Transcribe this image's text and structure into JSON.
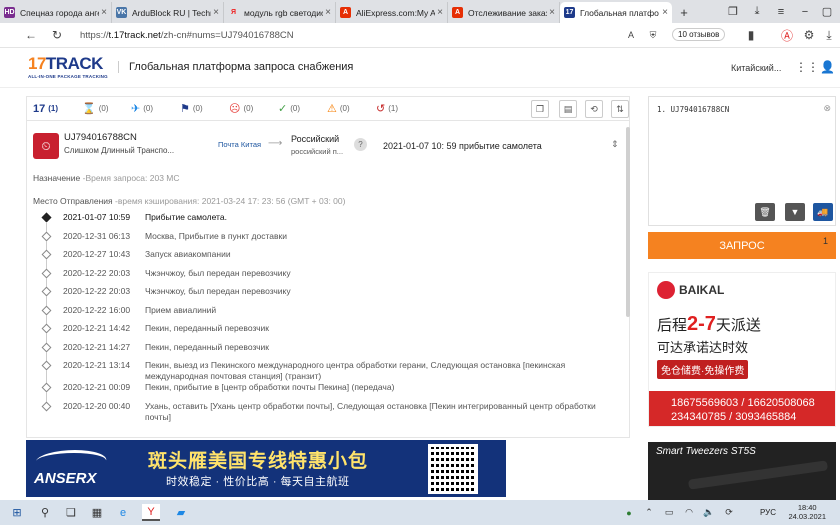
{
  "browser": {
    "tabs": [
      {
        "label": "Спецназ города анге",
        "favicon": "HD",
        "color": "#7a2d8f"
      },
      {
        "label": "ArduBlock RU | Techn",
        "favicon": "VK",
        "color": "#4a76a8"
      },
      {
        "label": "модуль rgb светодио",
        "favicon": "Я",
        "color": "#ffffff"
      },
      {
        "label": "AliExpress.com:My Al",
        "favicon": "A",
        "color": "#e62e04"
      },
      {
        "label": "Отслеживание заказ",
        "favicon": "A",
        "color": "#e62e04"
      },
      {
        "label": "Глобальная платфо",
        "favicon": "17",
        "color": "#1e3a8a",
        "active": true
      }
    ],
    "new_tab": "+",
    "url_prefix": "https://",
    "url_domain": "t.17track.net",
    "url_rest": "/zh-cn#nums=UJ794016788CN",
    "reviews_label": "10 отзывов"
  },
  "site": {
    "logo_main": "17TRACK",
    "logo_tagline": "ALL-IN-ONE PACKAGE TRACKING",
    "title": "Глобальная платформа запроса снабжения",
    "language": "Китайский..."
  },
  "filters": [
    {
      "icon": "17",
      "count": "(1)",
      "name": "all"
    },
    {
      "icon": "⌛",
      "count": "(0)",
      "name": "not-found"
    },
    {
      "icon": "✈",
      "count": "(0)",
      "name": "in-transit"
    },
    {
      "icon": "⚑",
      "count": "(0)",
      "name": "pick-up"
    },
    {
      "icon": "☹",
      "count": "(0)",
      "name": "undelivered"
    },
    {
      "icon": "✓",
      "count": "(0)",
      "name": "delivered"
    },
    {
      "icon": "⚠",
      "count": "(0)",
      "name": "alert"
    },
    {
      "icon": "↺",
      "count": "(1)",
      "name": "expired"
    }
  ],
  "shipment": {
    "number": "UJ794016788CN",
    "status": "Слишком Длинный Транспо...",
    "carrier": "Почта Китая",
    "dest_carrier": "Российский",
    "dest_carrier_sub": "российский п...",
    "latest": "2021-01-07 10: 59  прибытие самолета",
    "destination_label": "Назначение",
    "destination_note": "-Время запроса: 203 МС",
    "origin_label": "Место Отправления",
    "origin_note": "-время кэширования: 2021-03-24 17: 23: 56 (GMT + 03: 00)"
  },
  "events": [
    {
      "dt": "2021-01-07 10:59",
      "desc": "Прибытие самолета."
    },
    {
      "dt": "2020-12-31 06:13",
      "desc": "Москва, Прибытие в пункт доставки"
    },
    {
      "dt": "2020-12-27 10:43",
      "desc": "Запуск авиакомпании"
    },
    {
      "dt": "2020-12-22 20:03",
      "desc": "Чжэнчжоу, был передан перевозчику"
    },
    {
      "dt": "2020-12-22 20:03",
      "desc": "Чжэнчжоу, был передан перевозчику"
    },
    {
      "dt": "2020-12-22 16:00",
      "desc": "Прием авиалиний"
    },
    {
      "dt": "2020-12-21 14:42",
      "desc": "Пекин, переданный перевозчик"
    },
    {
      "dt": "2020-12-21 14:27",
      "desc": "Пекин, переданный перевозчик"
    },
    {
      "dt": "2020-12-21 13:14",
      "desc": "Пекин, выезд из Пекинского международного центра обработки герани, Следующая остановка [пекинская международная почтовая станция] (транзит)"
    },
    {
      "dt": "2020-12-21 00:09",
      "desc": "Пекин, прибытие в [центр обработки почты Пекина] (передача)"
    },
    {
      "dt": "2020-12-20 00:40",
      "desc": "Ухань, оставить [Ухань центр обработки почты], Следующая остановка [Пекин интегрированный центр обработки почты]"
    }
  ],
  "sidebar": {
    "input_text": "1. UJ794016788CN",
    "query_label": "ЗАПРОС",
    "query_count": "1"
  },
  "ads": {
    "banner_brand": "ANSERX",
    "banner_headline": "斑头雁美国专线特惠小包",
    "banner_sub": "时效稳定 · 性价比高 · 每天自主航班",
    "baikal_brand": "BAIKAL",
    "baikal_l1a": "后程",
    "baikal_l1b": "2-7",
    "baikal_l1c": "天派送",
    "baikal_l2": "可达承诺达时效",
    "baikal_l3": "免仓储费·免操作费",
    "baikal_phone1": "18675569603 / 16620508068",
    "baikal_phone2": "234340785 / 3093465884",
    "tweezers": "Smart Tweezers ST5S"
  },
  "taskbar": {
    "lang": "РУС",
    "time": "18:40",
    "date": "24.03.2021"
  }
}
